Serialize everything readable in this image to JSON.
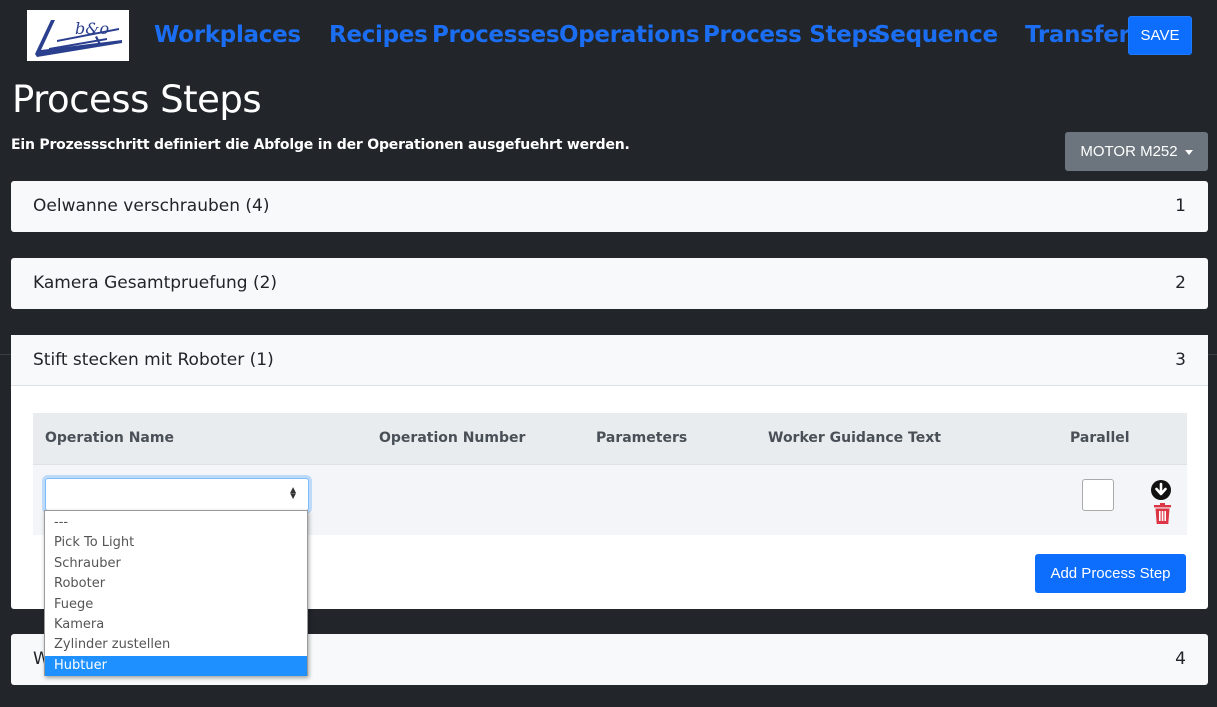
{
  "nav": {
    "logo_text": "b&o",
    "links": [
      "Workplaces",
      "Recipes",
      "Processes",
      "Operations",
      "Process Steps",
      "Sequence",
      "Transfer"
    ],
    "save_label": "SAVE"
  },
  "page": {
    "title": "Process Steps",
    "subtitle": "Ein Prozessschritt definiert die Abfolge in der Operationen ausgefuehrt werden.",
    "motor_label": "MOTOR M252"
  },
  "accordion": [
    {
      "title": "Oelwanne verschrauben (4)",
      "number": "1"
    },
    {
      "title": "Kamera Gesamtpruefung (2)",
      "number": "2"
    },
    {
      "title": "Stift stecken mit Roboter (1)",
      "number": "3"
    },
    {
      "title": "W",
      "number": "4"
    }
  ],
  "table": {
    "headers": [
      "Operation Name",
      "Operation Number",
      "Parameters",
      "Worker Guidance Text",
      "Parallel"
    ],
    "add_label": "Add Process Step"
  },
  "dropdown": {
    "options": [
      "---",
      "Pick To Light",
      "Schrauber",
      "Roboter",
      "Fuege",
      "Kamera",
      "Zylinder zustellen",
      "Hubtuer"
    ],
    "highlighted": "Hubtuer"
  },
  "colors": {
    "background": "#22262b",
    "nav_link": "#1b6ef2",
    "primary_button": "#0d6efd",
    "secondary_button": "#6c757d",
    "delete_icon": "#dc3545"
  }
}
